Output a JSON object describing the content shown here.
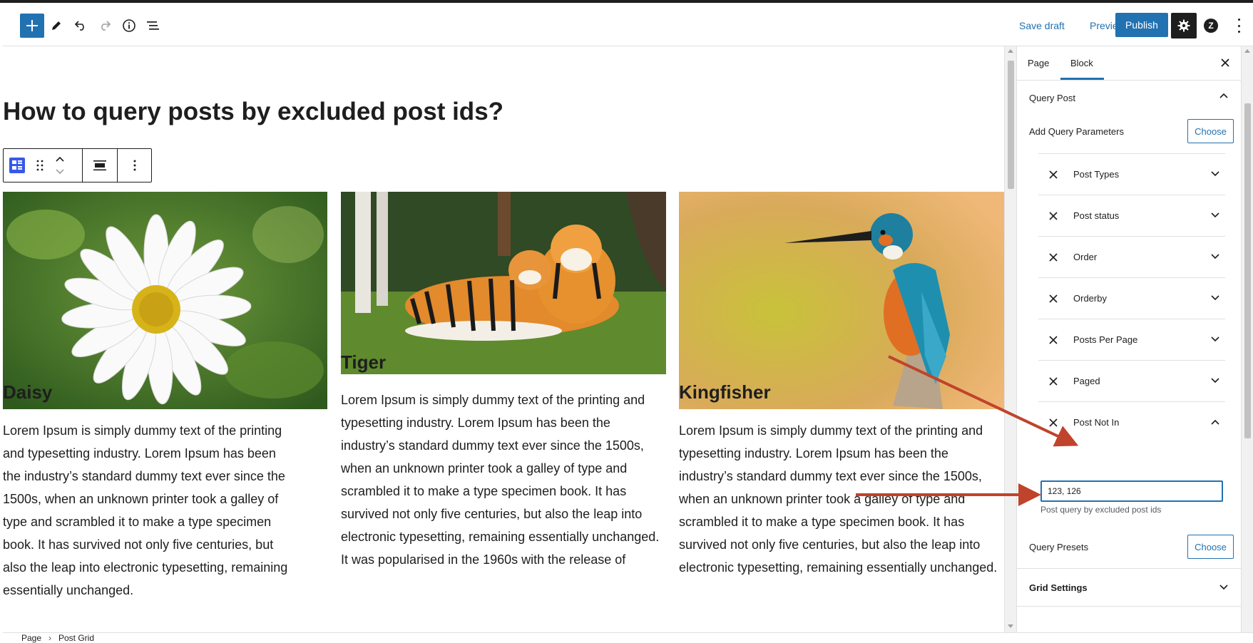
{
  "header": {
    "save_draft": "Save draft",
    "preview": "Preview",
    "publish": "Publish"
  },
  "icons": {
    "add": "plus-icon",
    "tools": "pencil-icon",
    "undo": "undo-icon",
    "redo": "redo-icon",
    "details": "info-icon",
    "list_view": "list-view-icon",
    "settings": "gear-icon",
    "plugin": "zz-logo-icon",
    "options": "kebab-icon"
  },
  "page": {
    "title": "How to query posts by excluded post ids?"
  },
  "posts": [
    {
      "title": "Daisy",
      "text": "Lorem Ipsum is simply dummy text of the printing and typesetting industry. Lorem Ipsum has been the industry’s standard dummy text ever since the 1500s, when an unknown printer took a galley of type and scrambled it to make a type specimen book. It has survived not only five centuries, but also the leap into electronic typesetting, remaining essentially unchanged."
    },
    {
      "title": "Tiger",
      "text": "Lorem Ipsum is simply dummy text of the printing and typesetting industry. Lorem Ipsum has been the industry’s standard dummy text ever since the 1500s, when an unknown printer took a galley of type and scrambled it to make a type specimen book. It has survived not only five centuries, but also the leap into electronic typesetting, remaining essentially unchanged. It was popularised in the 1960s with the release of"
    },
    {
      "title": "Kingfisher",
      "text": "Lorem Ipsum is simply dummy text of the printing and typesetting industry. Lorem Ipsum has been the industry’s standard dummy text ever since the 1500s, when an unknown printer took a galley of type and scrambled it to make a type specimen book. It has survived not only five centuries, but also the leap into electronic typesetting, remaining essentially unchanged."
    }
  ],
  "sidebar": {
    "tabs": [
      "Page",
      "Block"
    ],
    "active_tab": "Block",
    "query_post": {
      "title": "Query Post",
      "add_params_label": "Add Query Parameters",
      "choose_label": "Choose",
      "params": [
        {
          "label": "Post Types",
          "expanded": false
        },
        {
          "label": "Post status",
          "expanded": false
        },
        {
          "label": "Order",
          "expanded": false
        },
        {
          "label": "Orderby",
          "expanded": false
        },
        {
          "label": "Posts Per Page",
          "expanded": false
        },
        {
          "label": "Paged",
          "expanded": false
        },
        {
          "label": "Post Not In",
          "expanded": true
        }
      ],
      "post_not_in": {
        "value": "123, 126",
        "help": "Post query by excluded post ids"
      },
      "presets_label": "Query Presets",
      "presets_choose": "Choose"
    },
    "grid_settings": {
      "title": "Grid Settings"
    }
  },
  "breadcrumb": [
    "Page",
    "Post Grid"
  ],
  "colors": {
    "accent": "#2271b1",
    "annotation_arrow": "#c0432c",
    "dark": "#1e1e1e"
  }
}
